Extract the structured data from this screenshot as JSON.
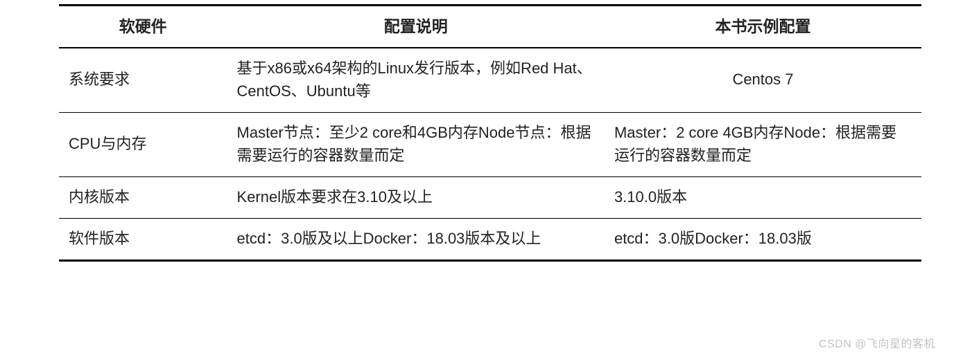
{
  "table": {
    "headers": [
      "软硬件",
      "配置说明",
      "本书示例配置"
    ],
    "rows": [
      {
        "col1": "系统要求",
        "col2": "基于x86或x64架构的Linux发行版本，例如Red Hat、CentOS、Ubuntu等",
        "col3": "Centos 7",
        "col3_align": "center"
      },
      {
        "col1": "CPU与内存",
        "col2": "Master节点：至少2 core和4GB内存Node节点：根据需要运行的容器数量而定",
        "col3": "Master：2 core 4GB内存Node：根据需要运行的容器数量而定",
        "col3_align": "top"
      },
      {
        "col1": "内核版本",
        "col2": "Kernel版本要求在3.10及以上",
        "col3": "3.10.0版本",
        "col3_align": "top"
      },
      {
        "col1": "软件版本",
        "col2": "etcd：3.0版及以上Docker：18.03版本及以上",
        "col3": "etcd：3.0版Docker：18.03版",
        "col3_align": "top"
      }
    ]
  },
  "watermark": "CSDN @飞向星的客机"
}
